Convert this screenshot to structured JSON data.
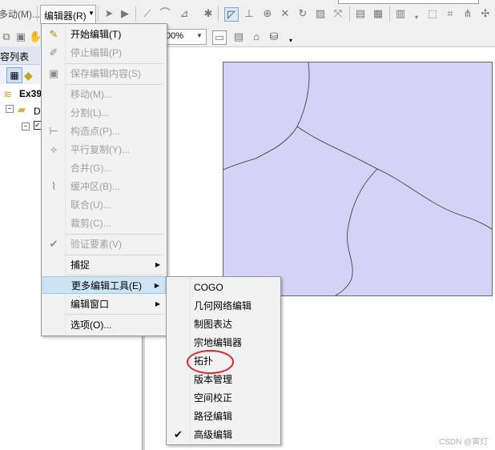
{
  "toolbar": {
    "move_menu_partial": "多动(M)...",
    "editor_menu": "编辑器(R)",
    "zoom_value": "00%"
  },
  "toc": {
    "header_partial": "容列表",
    "root_partial": "Ex39",
    "folder_partial": "D"
  },
  "editor_menu": {
    "items": [
      {
        "label": "开始编辑(T)",
        "enabled": true,
        "icon": "start-edit-icon"
      },
      {
        "label": "停止编辑(P)",
        "enabled": false,
        "icon": "stop-edit-icon"
      },
      {
        "label": "保存编辑内容(S)",
        "enabled": false,
        "icon": "save-edits-icon"
      },
      {
        "label": "移动(M)...",
        "enabled": false
      },
      {
        "label": "分割(L)...",
        "enabled": false
      },
      {
        "label": "构造点(P)...",
        "enabled": false,
        "icon": "construct-points-icon"
      },
      {
        "label": "平行复制(Y)...",
        "enabled": false,
        "icon": "copy-parallel-icon"
      },
      {
        "label": "合并(G)...",
        "enabled": false
      },
      {
        "label": "缓冲区(B)...",
        "enabled": false,
        "icon": "buffer-icon"
      },
      {
        "label": "联合(U)...",
        "enabled": false
      },
      {
        "label": "裁剪(C)...",
        "enabled": false
      },
      {
        "label": "验证要素(V)",
        "enabled": false,
        "icon": "validate-features-icon"
      },
      {
        "label": "捕捉",
        "enabled": true,
        "submenu": true
      },
      {
        "label": "更多编辑工具(E)",
        "enabled": true,
        "submenu": true,
        "highlighted": true
      },
      {
        "label": "编辑窗口",
        "enabled": true,
        "submenu": true
      },
      {
        "label": "选项(O)...",
        "enabled": true
      }
    ]
  },
  "more_tools_submenu": {
    "items": [
      {
        "label": "COGO",
        "checked": false
      },
      {
        "label": "几何网络编辑",
        "checked": false
      },
      {
        "label": "制图表达",
        "checked": false
      },
      {
        "label": "宗地编辑器",
        "checked": false
      },
      {
        "label": "拓扑",
        "checked": false,
        "annotated": true
      },
      {
        "label": "版本管理",
        "checked": false
      },
      {
        "label": "空间校正",
        "checked": false
      },
      {
        "label": "路径编辑",
        "checked": false
      },
      {
        "label": "高级编辑",
        "checked": true
      }
    ]
  },
  "map": {
    "fill_color": "#d4d2f5",
    "line_color": "#333333"
  },
  "annotation_color": "#e0242a",
  "watermark": "CSDN @寅灯"
}
